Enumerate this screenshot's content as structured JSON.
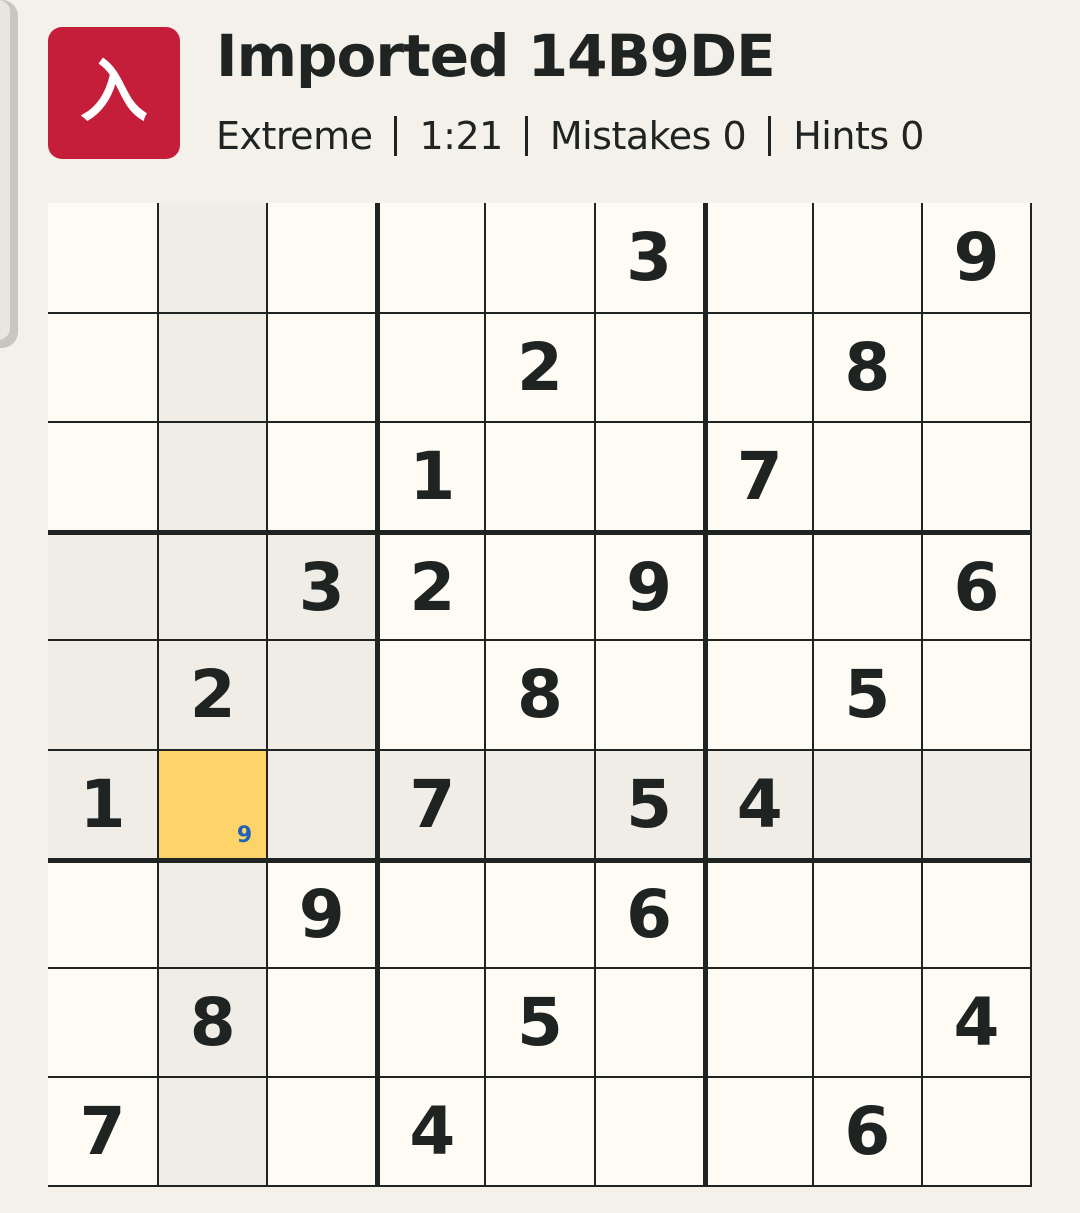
{
  "header": {
    "logo_glyph": "入",
    "title": "Imported 14B9DE",
    "difficulty": "Extreme",
    "timer": "1:21",
    "mistakes": "Mistakes 0",
    "hints": "Hints 0"
  },
  "colors": {
    "brand": "#c41e3a",
    "selected": "#fdd36a",
    "peer": "#efede6",
    "cell": "#fdfbf4",
    "note": "#1f63b8"
  },
  "board": {
    "selected": [
      5,
      1
    ],
    "notes": {
      "5-1": "9"
    },
    "grid": [
      [
        "",
        "",
        "",
        "",
        "",
        "3",
        "",
        "",
        "9"
      ],
      [
        "",
        "",
        "",
        "",
        "2",
        "",
        "",
        "8",
        ""
      ],
      [
        "",
        "",
        "",
        "1",
        "",
        "",
        "7",
        "",
        ""
      ],
      [
        "",
        "",
        "3",
        "2",
        "",
        "9",
        "",
        "",
        "6"
      ],
      [
        "",
        "2",
        "",
        "",
        "8",
        "",
        "",
        "5",
        ""
      ],
      [
        "1",
        "",
        "",
        "7",
        "",
        "5",
        "4",
        "",
        ""
      ],
      [
        "",
        "",
        "9",
        "",
        "",
        "6",
        "",
        "",
        ""
      ],
      [
        "",
        "8",
        "",
        "",
        "5",
        "",
        "",
        "",
        "4"
      ],
      [
        "7",
        "",
        "",
        "4",
        "",
        "",
        "",
        "6",
        ""
      ]
    ]
  }
}
